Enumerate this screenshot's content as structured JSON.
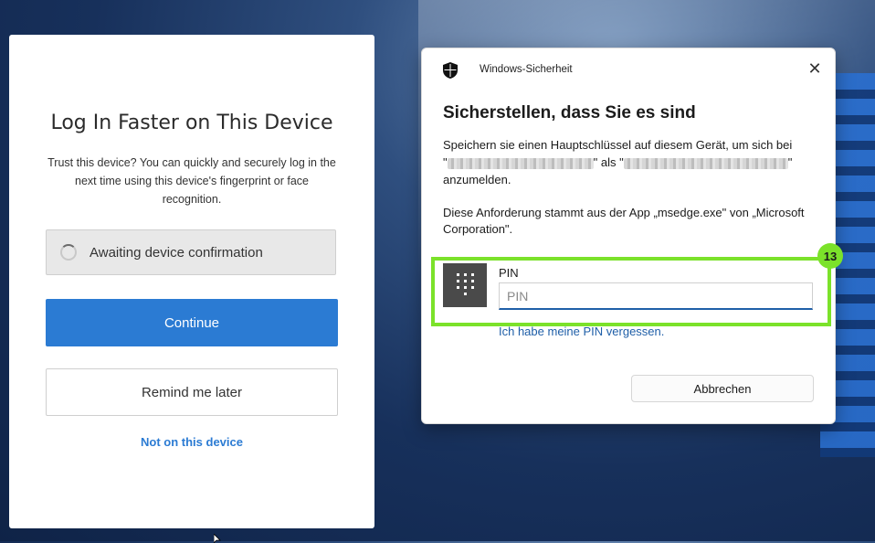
{
  "login": {
    "title": "Log In Faster on This Device",
    "description": "Trust this device? You can quickly and securely log in the next time using this device's fingerprint or face recognition.",
    "awaiting_label": "Awaiting device confirmation",
    "continue_label": "Continue",
    "remind_label": "Remind me later",
    "not_device_label": "Not on this device"
  },
  "dialog": {
    "app_title": "Windows-Sicherheit",
    "heading": "Sicherstellen, dass Sie es sind",
    "text_part1": "Speichern sie einen Hauptschlüssel auf diesem Gerät, um sich bei",
    "text_quote_open": "\"",
    "text_als": "\" als \"",
    "text_quote_close": "\"",
    "text_part2": "anzumelden.",
    "origin_text": "Diese Anforderung stammt aus der App „msedge.exe\" von „Microsoft Corporation\".",
    "pin_label": "PIN",
    "pin_placeholder": "PIN",
    "pin_value": "",
    "forgot_pin": "Ich habe meine PIN vergessen.",
    "cancel_label": "Abbrechen"
  },
  "annotation": {
    "badge": "13",
    "color": "#7be22a"
  },
  "icons": {
    "shield": "shield-icon",
    "close": "close-icon",
    "keypad": "keypad-icon",
    "spinner": "spinner-icon"
  }
}
